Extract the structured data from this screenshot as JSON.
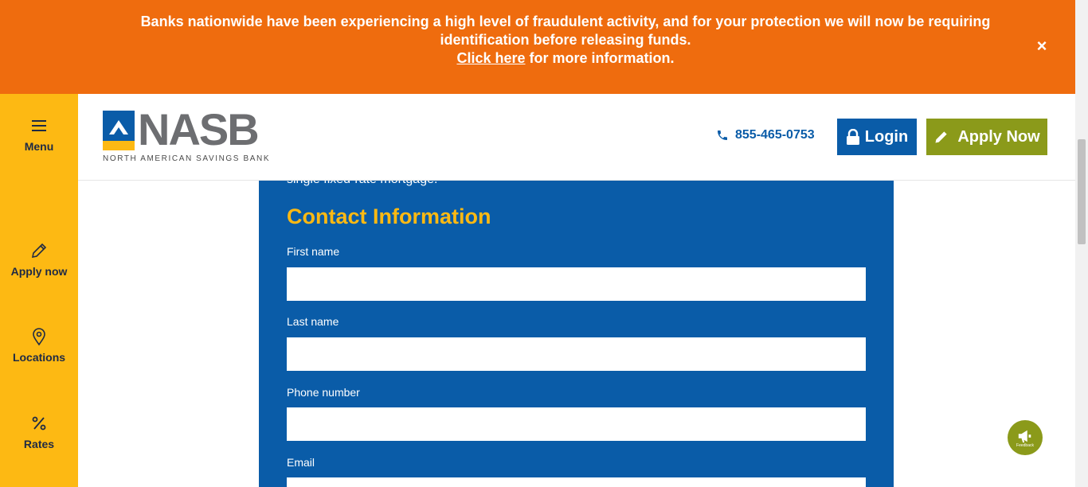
{
  "alert": {
    "line1": "Banks nationwide have been experiencing a high level of fraudulent activity, and for your protection we will now be requiring",
    "line2": "identification before releasing funds.",
    "link": "Click here",
    "link_suffix": " for more information.",
    "close": "×"
  },
  "sidebar": {
    "items": [
      {
        "label": "Menu",
        "icon": "hamburger-icon"
      },
      {
        "label": "Apply now",
        "icon": "pencil-icon"
      },
      {
        "label": "Locations",
        "icon": "map-pin-icon"
      },
      {
        "label": "Rates",
        "icon": "percent-icon"
      }
    ]
  },
  "header": {
    "logo_word": "NASB",
    "logo_sub": "NORTH AMERICAN SAVINGS BANK",
    "phone": "855-465-0753",
    "login": "Login",
    "apply": "Apply Now"
  },
  "form": {
    "cutoff_text": "single fixed-rate mortgage.",
    "section_title": "Contact Information",
    "fields": [
      {
        "label": "First name",
        "value": ""
      },
      {
        "label": "Last name",
        "value": ""
      },
      {
        "label": "Phone number",
        "value": ""
      },
      {
        "label": "Email",
        "value": ""
      }
    ]
  },
  "feedback": {
    "label": "Feedback"
  },
  "colors": {
    "banner_orange": "#ef6c0e",
    "sidebar_yellow": "#fdb913",
    "brand_blue": "#0a5ca8",
    "apply_green": "#8b9a1a"
  }
}
